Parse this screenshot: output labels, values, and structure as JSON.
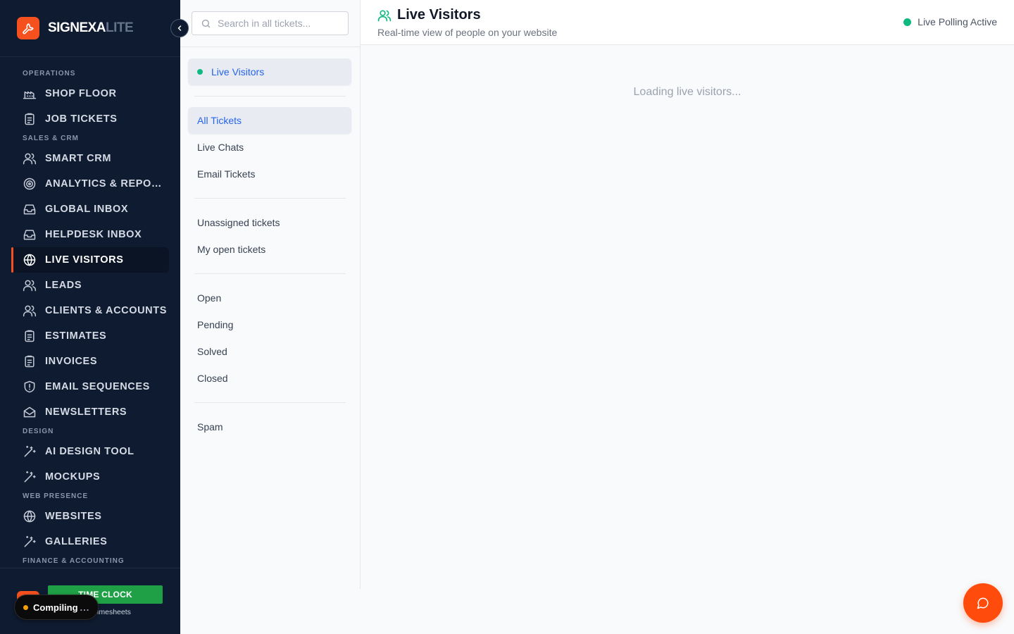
{
  "app": {
    "brand_main": "SIGNEXA",
    "brand_suffix": "LITE",
    "colors": {
      "sidebar_bg": "#0f1b30",
      "accent": "#f4511e",
      "active_link": "#2563eb",
      "status_green": "#10b981",
      "time_clock_green": "#1fa046"
    }
  },
  "sidebar": {
    "sections": [
      {
        "title": "OPERATIONS",
        "items": [
          {
            "label": "SHOP FLOOR",
            "icon": "factory-icon"
          },
          {
            "label": "JOB TICKETS",
            "icon": "clipboard-icon"
          }
        ]
      },
      {
        "title": "SALES & CRM",
        "items": [
          {
            "label": "SMART CRM",
            "icon": "users-icon"
          },
          {
            "label": "ANALYTICS & REPORTS",
            "icon": "target-icon"
          },
          {
            "label": "GLOBAL INBOX",
            "icon": "inbox-icon"
          },
          {
            "label": "HELPDESK INBOX",
            "icon": "inbox-icon"
          },
          {
            "label": "LIVE VISITORS",
            "icon": "globe-icon",
            "active": true
          },
          {
            "label": "LEADS",
            "icon": "users-icon"
          },
          {
            "label": "CLIENTS & ACCOUNTS",
            "icon": "users-icon"
          },
          {
            "label": "ESTIMATES",
            "icon": "clipboard-icon"
          },
          {
            "label": "INVOICES",
            "icon": "clipboard-icon"
          },
          {
            "label": "EMAIL SEQUENCES",
            "icon": "shield-icon"
          },
          {
            "label": "NEWSLETTERS",
            "icon": "mail-open-icon"
          }
        ]
      },
      {
        "title": "DESIGN",
        "items": [
          {
            "label": "AI DESIGN TOOL",
            "icon": "magic-wand-icon"
          },
          {
            "label": "MOCKUPS",
            "icon": "magic-wand-icon"
          }
        ]
      },
      {
        "title": "WEB PRESENCE",
        "items": [
          {
            "label": "WEBSITES",
            "icon": "globe-icon"
          },
          {
            "label": "GALLERIES",
            "icon": "magic-wand-icon"
          }
        ]
      },
      {
        "title": "FINANCE & ACCOUNTING",
        "items": []
      }
    ],
    "footer": {
      "time_clock_label": "TIME CLOCK",
      "timesheets_label": "Timesheets",
      "compiling_label": "Compiling",
      "compiling_ellipsis": "..."
    }
  },
  "tickets_panel": {
    "search_placeholder": "Search in all tickets...",
    "groups": [
      [
        {
          "label": "Live Visitors",
          "selected": true,
          "dot": true
        }
      ],
      [
        {
          "label": "All Tickets",
          "selected": true
        },
        {
          "label": "Live Chats"
        },
        {
          "label": "Email Tickets"
        }
      ],
      [
        {
          "label": "Unassigned tickets"
        },
        {
          "label": "My open tickets"
        }
      ],
      [
        {
          "label": "Open"
        },
        {
          "label": "Pending"
        },
        {
          "label": "Solved"
        },
        {
          "label": "Closed"
        }
      ],
      [
        {
          "label": "Spam"
        }
      ]
    ]
  },
  "main": {
    "title": "Live Visitors",
    "subtitle": "Real-time view of people on your website",
    "status": "Live Polling Active",
    "loading_text": "Loading live visitors..."
  }
}
